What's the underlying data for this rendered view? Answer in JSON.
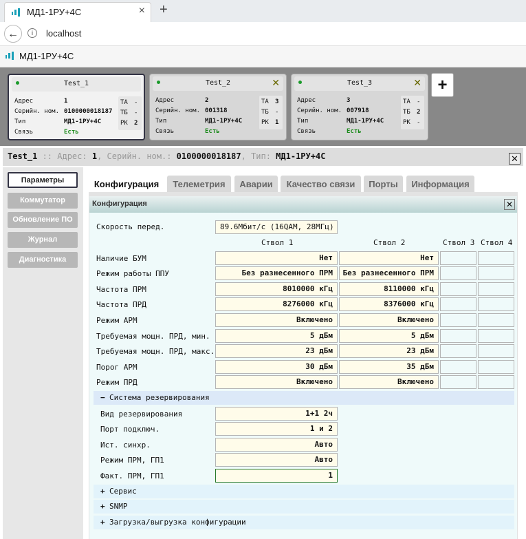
{
  "browser": {
    "tab_title": "МД1-1РУ+4С",
    "tab_close": "×",
    "new_tab": "+",
    "url": "localhost",
    "app_title": "МД1-1РУ+4С"
  },
  "devices": [
    {
      "name": "Test_1",
      "addr_label": "Адрес",
      "addr": "1",
      "serial_label": "Серийн. ном.",
      "serial": "0100000018187",
      "type_label": "Тип",
      "type": "МД1-1РУ+4С",
      "link_label": "Связь",
      "link": "Есть",
      "ta_label": "ТА",
      "ta": "-",
      "tb_label": "ТБ",
      "tb": "-",
      "rk_label": "РК",
      "rk": "2",
      "close": ""
    },
    {
      "name": "Test_2",
      "addr_label": "Адрес",
      "addr": "2",
      "serial_label": "Серийн. ном.",
      "serial": "001318",
      "type_label": "Тип",
      "type": "МД1-1РУ+4С",
      "link_label": "Связь",
      "link": "Есть",
      "ta_label": "ТА",
      "ta": "3",
      "tb_label": "ТБ",
      "tb": "-",
      "rk_label": "РК",
      "rk": "1",
      "close": "✕"
    },
    {
      "name": "Test_3",
      "addr_label": "Адрес",
      "addr": "3",
      "serial_label": "Серийн. ном.",
      "serial": "007918",
      "type_label": "Тип",
      "type": "МД1-1РУ+4С",
      "link_label": "Связь",
      "link": "Есть",
      "ta_label": "ТА",
      "ta": "-",
      "tb_label": "ТБ",
      "tb": "2",
      "rk_label": "РК",
      "rk": "-",
      "close": "✕"
    }
  ],
  "add_device": "+",
  "infobar": {
    "name": "Test_1",
    "sep1": " :: Адрес: ",
    "addr": "1",
    "sep2": ", Серийн. ном.: ",
    "serial": "0100000018187",
    "sep3": ", Тип: ",
    "type": "МД1-1РУ+4С",
    "close": "✕"
  },
  "menu": [
    "Параметры",
    "Коммутатор",
    "Обновление ПО",
    "Журнал",
    "Диагностика"
  ],
  "tabs": [
    "Конфигурация",
    "Телеметрия",
    "Аварии",
    "Качество связи",
    "Порты",
    "Информация"
  ],
  "panel": {
    "title": "Конфигурация",
    "close": "✕",
    "speed_label": "Скорость перед.",
    "speed": "89.6Мбит/с (16QAM, 28МГц)",
    "columns": [
      "Ствол 1",
      "Ствол 2",
      "Ствол 3",
      "Ствол 4"
    ],
    "rows": [
      {
        "label": "Наличие БУМ",
        "v1": "Нет",
        "v2": "Нет"
      },
      {
        "label": "Режим работы ППУ",
        "v1": "Без разнесенного ПРМ",
        "v2": "Без разнесенного ПРМ"
      },
      {
        "label": "Частота ПРМ",
        "v1": "8010000 кГц",
        "v2": "8110000 кГц"
      },
      {
        "label": "Частота ПРД",
        "v1": "8276000 кГц",
        "v2": "8376000 кГц"
      },
      {
        "label": "Режим АРМ",
        "v1": "Включено",
        "v2": "Включено"
      },
      {
        "label": "Требуемая мощн. ПРД, мин.",
        "v1": "5 дБм",
        "v2": "5 дБм"
      },
      {
        "label": "Требуемая мощн. ПРД, макс.",
        "v1": "23 дБм",
        "v2": "23 дБм"
      },
      {
        "label": "Порог АРМ",
        "v1": "30 дБм",
        "v2": "35 дБм"
      },
      {
        "label": "Режим ПРД",
        "v1": "Включено",
        "v2": "Включено"
      }
    ],
    "reserve": {
      "sign": "−",
      "title": "Система резервирования",
      "rows": [
        {
          "label": "Вид резервирования",
          "value": "1+1 2ч"
        },
        {
          "label": "Порт подключ.",
          "value": "1 и 2"
        },
        {
          "label": "Ист. синхр.",
          "value": "Авто"
        },
        {
          "label": "Режим ПРМ, ГП1",
          "value": "Авто"
        },
        {
          "label": "Факт. ПРМ, ГП1",
          "value": "1"
        }
      ]
    },
    "sections": [
      {
        "sign": "+",
        "title": "Сервис"
      },
      {
        "sign": "+",
        "title": "SNMP"
      },
      {
        "sign": "+",
        "title": "Загрузка/выгрузка конфигурации"
      }
    ]
  }
}
